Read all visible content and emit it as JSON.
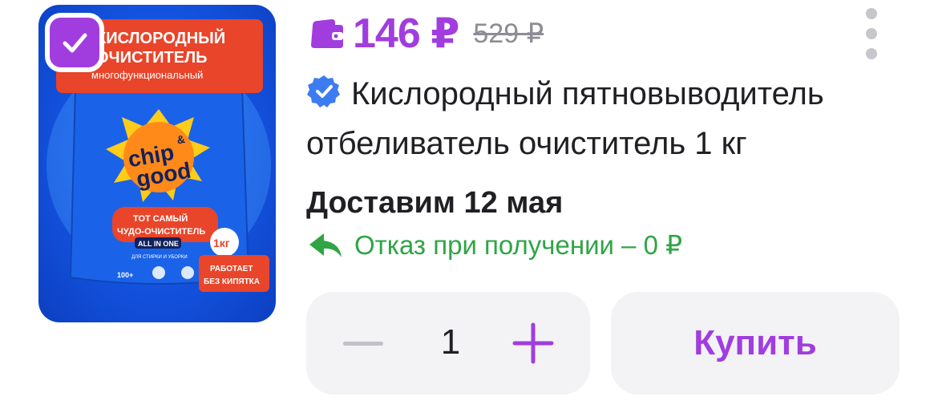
{
  "product": {
    "image_alt": "Кислородный очиститель Chip & Good",
    "image_texts": {
      "banner_line1": "КИСЛОРОДНЫЙ",
      "banner_line2": "ОЧИСТИТЕЛЬ",
      "banner_line3": "многофункциональный",
      "brand_line1": "chip",
      "brand_line2": "good",
      "brand_amp": "&",
      "slogan_line1": "ТОТ САМЫЙ",
      "slogan_line2": "ЧУДО-ОЧИСТИТЕЛЬ",
      "badge_all_in_one": "ALL IN ONE",
      "sub_text": "ДЛЯ СТИРКИ И УБОРКИ",
      "weight_badge": "1кг",
      "no_boil_line1": "РАБОТАЕТ",
      "no_boil_line2": "БЕЗ КИПЯТКА",
      "uses": "100+"
    },
    "selected": true
  },
  "price": {
    "current": "146 ₽",
    "old": "529 ₽"
  },
  "title": "Кислородный пятновыводитель отбеливатель очиститель 1 кг",
  "delivery": "Доставим 12 мая",
  "return_policy": "Отказ при получении – 0 ₽",
  "quantity": {
    "value": "1"
  },
  "buy_label": "Купить",
  "colors": {
    "accent": "#a13ddf",
    "green": "#2fa545",
    "verified": "#3d7cf0",
    "muted": "#8d8d96",
    "button_bg": "#f3f3f6"
  },
  "icons": {
    "checkbox": "check-icon",
    "wallet": "wallet-icon",
    "more": "more-vertical-icon",
    "verified": "verified-badge-icon",
    "return": "return-arrow-icon",
    "minus": "minus-icon",
    "plus": "plus-icon"
  }
}
